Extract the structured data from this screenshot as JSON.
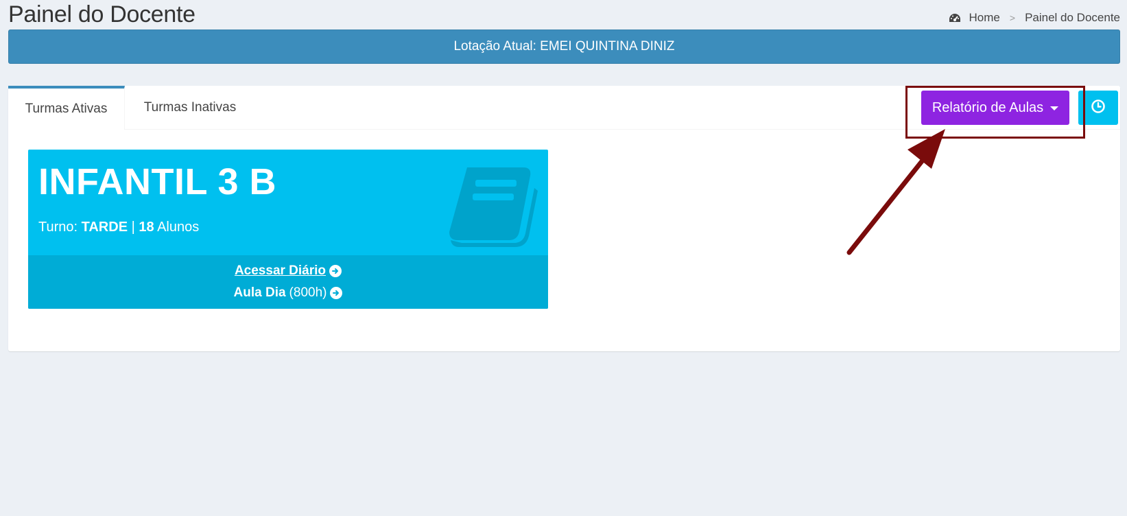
{
  "header": {
    "title": "Painel do Docente",
    "breadcrumb": {
      "home": "Home",
      "separator": ">",
      "current": "Painel do Docente"
    }
  },
  "banner": {
    "text": "Lotação Atual: EMEI QUINTINA DINIZ"
  },
  "tabs": [
    {
      "label": "Turmas Ativas",
      "active": true
    },
    {
      "label": "Turmas Inativas",
      "active": false
    }
  ],
  "toolbar": {
    "relatorio_label": "Relatório de Aulas",
    "relatorio_color": "#8e24e1",
    "clock_color": "#00c0ef"
  },
  "turma": {
    "name": "INFANTIL 3 B",
    "turno_label": "Turno:",
    "turno_value": "TARDE",
    "divider": "|",
    "alunos_count": "18",
    "alunos_label": "Alunos",
    "acessar_label": "Acessar Diário",
    "aula_label": "Aula Dia",
    "aula_hours": "(800h)",
    "color": "#00c0ef"
  },
  "icons": {
    "breadcrumb": "dashboard-icon",
    "card": "book-icon",
    "clock": "clock-icon",
    "link_arrow": "arrow-circle-right-icon"
  },
  "annotation": {
    "color": "#7a0b0b"
  }
}
